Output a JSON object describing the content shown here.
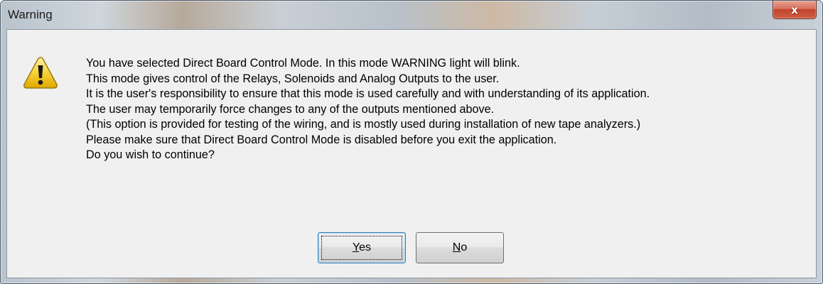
{
  "window": {
    "title": "Warning",
    "close_glyph": "x"
  },
  "dialog": {
    "icon": "warning-triangle-icon",
    "message_lines": [
      "You have selected Direct Board Control Mode. In this mode WARNING light will blink.",
      "This mode gives control of the Relays, Solenoids and Analog Outputs to the user.",
      "It is the user's responsibility to ensure that this mode is used carefully and with understanding of its application.",
      "The user may temporarily force changes to any of the outputs mentioned above.",
      "(This option is provided for testing of the wiring, and is mostly used during installation of new tape analyzers.)",
      "Please make sure that Direct Board Control Mode is disabled before you exit the application.",
      "Do you wish to continue?"
    ]
  },
  "buttons": {
    "yes": {
      "mnemonic": "Y",
      "rest": "es"
    },
    "no": {
      "mnemonic": "N",
      "rest": "o"
    }
  },
  "colors": {
    "client_bg": "#f0f0f0",
    "close_red": "#c1432c",
    "focus_blue": "#3c7fb1"
  }
}
